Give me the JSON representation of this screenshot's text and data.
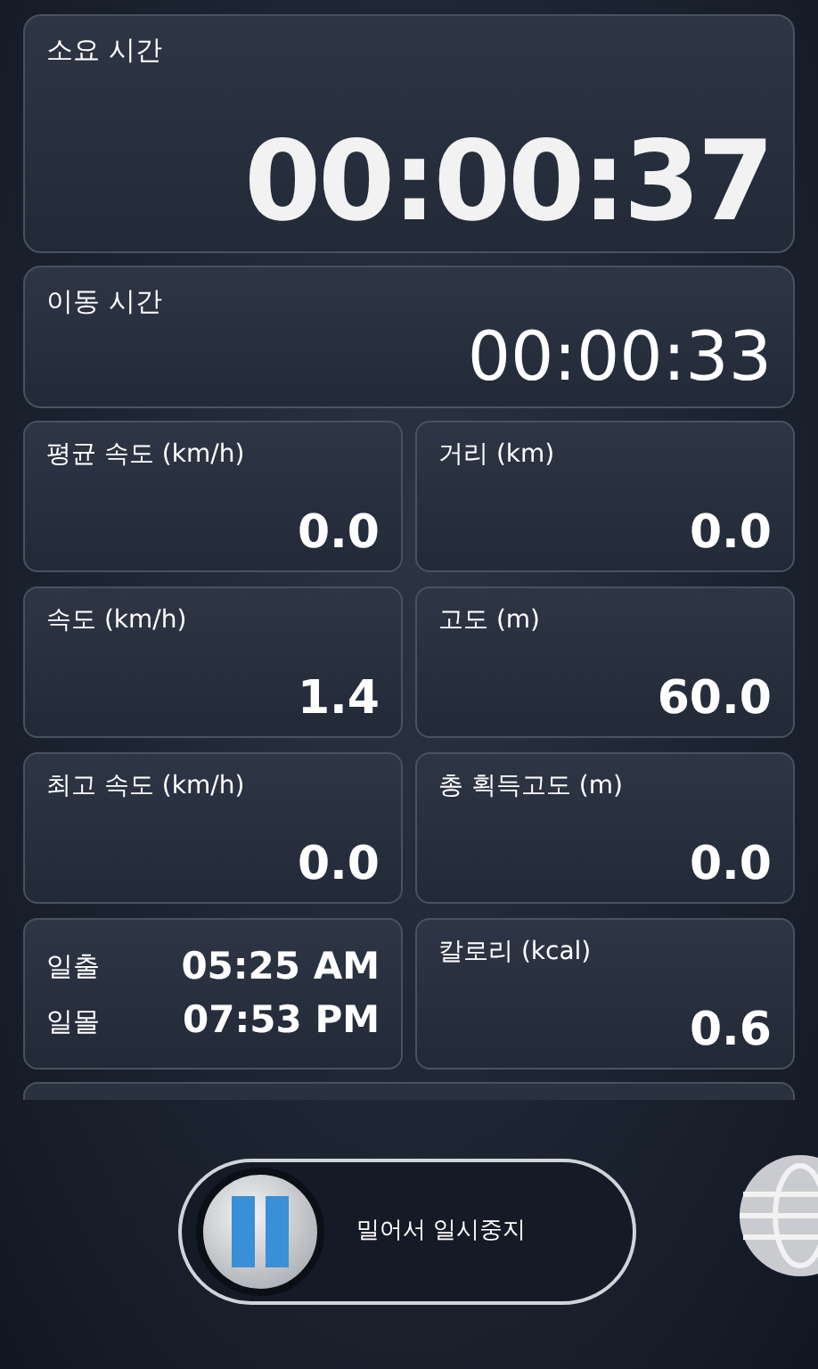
{
  "elapsed": {
    "label": "소요 시간",
    "value": "00:00:37"
  },
  "moving": {
    "label": "이동 시간",
    "value": "00:00:33"
  },
  "stats": [
    {
      "kind": "stat",
      "label": "평균 속도 (km/h)",
      "value": "0.0"
    },
    {
      "kind": "stat",
      "label": "거리 (km)",
      "value": "0.0"
    },
    {
      "kind": "stat",
      "label": "속도 (km/h)",
      "value": "1.4"
    },
    {
      "kind": "stat",
      "label": "고도 (m)",
      "value": "60.0"
    },
    {
      "kind": "stat",
      "label": "최고 속도 (km/h)",
      "value": "0.0"
    },
    {
      "kind": "stat",
      "label": "총 획득고도 (m)",
      "value": "0.0"
    },
    {
      "kind": "sun",
      "rows": [
        {
          "label": "일출",
          "value": "05:25 AM"
        },
        {
          "label": "일몰",
          "value": "07:53 PM"
        }
      ]
    },
    {
      "kind": "stat",
      "label": "칼로리 (kcal)",
      "value": "0.6"
    }
  ],
  "slider": {
    "label": "밀어서 일시중지",
    "level": 0
  }
}
